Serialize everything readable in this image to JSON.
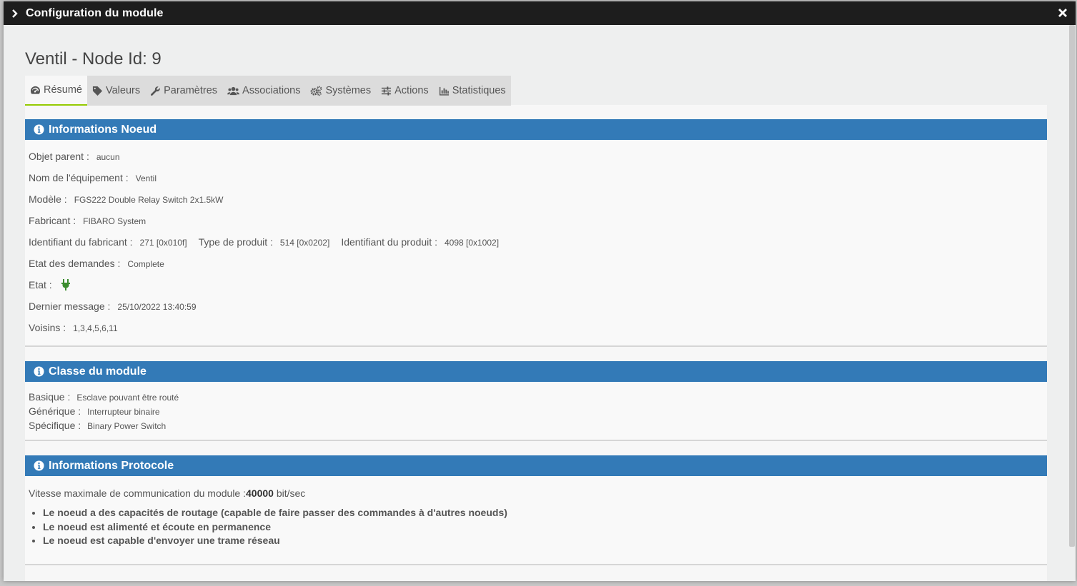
{
  "modal": {
    "title": "Configuration du module"
  },
  "page_title": "Ventil - Node Id: 9",
  "tabs": [
    {
      "label": "Résumé",
      "icon": "dashboard-icon"
    },
    {
      "label": "Valeurs",
      "icon": "tag-icon"
    },
    {
      "label": "Paramètres",
      "icon": "wrench-icon"
    },
    {
      "label": "Associations",
      "icon": "users-icon"
    },
    {
      "label": "Systèmes",
      "icon": "gears-icon"
    },
    {
      "label": "Actions",
      "icon": "sliders-icon"
    },
    {
      "label": "Statistiques",
      "icon": "bar-chart-icon"
    }
  ],
  "node_info": {
    "heading": "Informations Noeud",
    "parent_label": "Objet parent :",
    "parent_value": "aucun",
    "name_label": "Nom de l'équipement :",
    "name_value": "Ventil",
    "model_label": "Modèle :",
    "model_value": "FGS222 Double Relay Switch 2x1.5kW",
    "manufacturer_label": "Fabricant :",
    "manufacturer_value": "FIBARO System",
    "manufacturer_id_label": "Identifiant du fabricant :",
    "manufacturer_id_value": "271 [0x010f]",
    "product_type_label": "Type de produit :",
    "product_type_value": "514 [0x0202]",
    "product_id_label": "Identifiant du produit :",
    "product_id_value": "4098 [0x1002]",
    "query_state_label": "Etat des demandes :",
    "query_state_value": "Complete",
    "state_label": "Etat :",
    "state_icon": "plug-icon",
    "state_color": "#3c8d2f",
    "last_message_label": "Dernier message :",
    "last_message_value": "25/10/2022 13:40:59",
    "neighbors_label": "Voisins :",
    "neighbors_value": "1,3,4,5,6,11"
  },
  "module_class": {
    "heading": "Classe du module",
    "basic_label": "Basique :",
    "basic_value": "Esclave pouvant être routé",
    "generic_label": "Générique :",
    "generic_value": "Interrupteur binaire",
    "specific_label": "Spécifique :",
    "specific_value": "Binary Power Switch"
  },
  "protocol": {
    "heading": "Informations Protocole",
    "speed_label": "Vitesse maximale de communication du module :",
    "speed_value": "40000",
    "speed_unit": " bit/sec",
    "capabilities": [
      "Le noeud a des capacités de routage (capable de faire passer des commandes à d'autres noeuds)",
      "Le noeud est alimenté et écoute en permanence",
      "Le noeud est capable d'envoyer une trame réseau"
    ]
  },
  "colors": {
    "titlebar_bg": "#1d1d1d",
    "panel_heading_bg": "#337ab7",
    "active_tab_underline": "#94ca02"
  }
}
